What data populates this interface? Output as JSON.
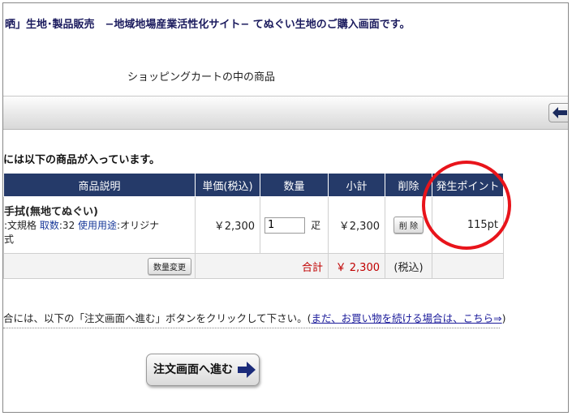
{
  "header": {
    "title": "晒」生地･製品販売　−地域地場産業活性化サイト− てぬぐい生地のご購入画面です。"
  },
  "cart_heading": "ショッピングカートの中の商品",
  "intro": "には以下の商品が入っています。",
  "table": {
    "headers": [
      "商品説明",
      "単価(税込)",
      "数量",
      "小計",
      "削除",
      "発生ポイント"
    ],
    "item": {
      "name": "手拭(無地てぬぐい)",
      "spec_prefix": ":文規格",
      "count_label": "取数",
      "count_value": ":32",
      "usage_label": "使用用途",
      "usage_value": ":オリジナ",
      "desc_end": "式",
      "price": "￥2,300",
      "quantity": "1",
      "unit": "疋",
      "subtotal": "￥2,300",
      "delete_label": "削 除",
      "points": "115pt"
    },
    "totals": {
      "change_qty_label": "数量変更",
      "total_label": "合計",
      "total_value": "￥ 2,300",
      "tax_note": "(税込)"
    }
  },
  "info": {
    "text": "合には、以下の「注文画面へ進む」ボタンをクリックして下さい。(",
    "link": "まだ、お買い物を続ける場合は、こちら⇒",
    "close": ")"
  },
  "proceed_button": "注文画面へ進む",
  "colors": {
    "header_bg": "#253a69",
    "highlight": "#e8141b",
    "total_red": "#c00000"
  }
}
